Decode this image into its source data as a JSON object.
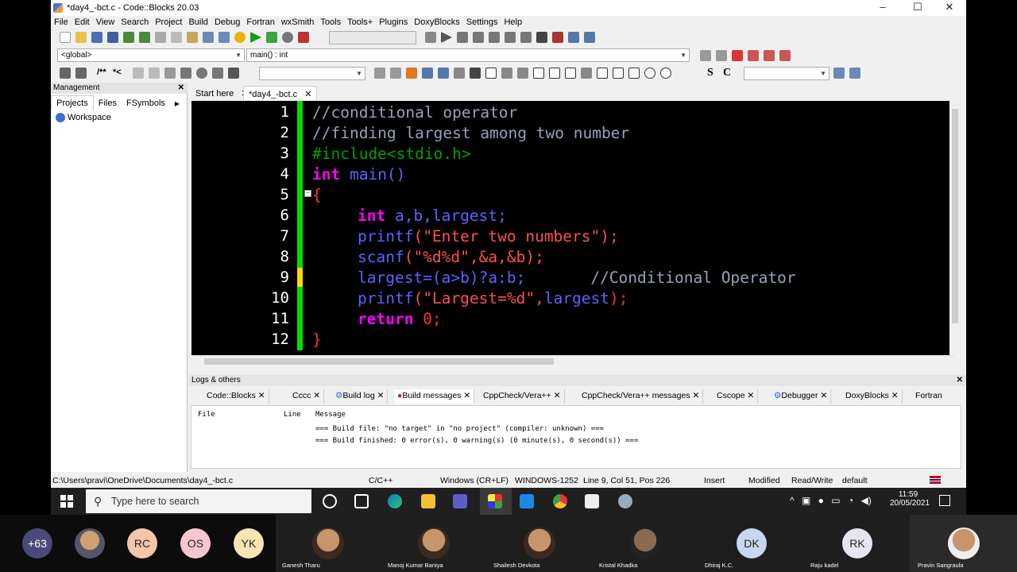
{
  "window": {
    "title": "*day4_-bct.c - Code::Blocks 20.03",
    "controls": [
      "–",
      "☐",
      "✕"
    ]
  },
  "menu": [
    "File",
    "Edit",
    "View",
    "Search",
    "Project",
    "Build",
    "Debug",
    "Fortran",
    "wxSmith",
    "Tools",
    "Tools+",
    "Plugins",
    "DoxyBlocks",
    "Settings",
    "Help"
  ],
  "scope": {
    "global": "<global>",
    "function": "main() : int"
  },
  "toolbar3": {
    "comment_btn": "/**",
    "uncomment_btn": "*<",
    "s_btn": "S",
    "c_btn": "C"
  },
  "management": {
    "header": "Management",
    "tabs": [
      "Projects",
      "Files",
      "FSymbols"
    ],
    "workspace": "Workspace"
  },
  "editor_tabs": [
    "Start here",
    "*day4_-bct.c"
  ],
  "line_numbers": [
    "1",
    "2",
    "3",
    "4",
    "5",
    "6",
    "7",
    "8",
    "9",
    "10",
    "11",
    "12"
  ],
  "code": {
    "l1": "//conditional operator",
    "l2": "//finding largest among two number",
    "l3": "#include<stdio.h>",
    "l4_kw": "int",
    "l4_rest": " main()",
    "l5": "{",
    "l6_kw": "int",
    "l6_rest": " a,b,largest;",
    "l7_fn": "printf",
    "l7_str": "(\"Enter two numbers\");",
    "l8_fn": "scanf",
    "l8_str": "(\"%d%d\",&a,&b);",
    "l9_code": "largest=(a>b)?a:b;",
    "l9_comment": "//Conditional Operator",
    "l10_fn": "printf",
    "l10_str": "(\"Largest=%d\",",
    "l10_var": "largest",
    "l10_end": ");",
    "l11_kw": "return",
    "l11_rest": " 0;",
    "l12": "}"
  },
  "logs": {
    "header": "Logs & others",
    "tabs": [
      "Code::Blocks",
      "Cccc",
      "Build log",
      "Build messages",
      "CppCheck/Vera++",
      "CppCheck/Vera++ messages",
      "Cscope",
      "Debugger",
      "DoxyBlocks",
      "Fortran"
    ],
    "columns": [
      "File",
      "Line",
      "Message"
    ],
    "messages": [
      "=== Build file: \"no target\" in \"no project\" (compiler: unknown) ===",
      "=== Build finished: 0 error(s), 0 warning(s) (0 minute(s), 0 second(s)) ==="
    ]
  },
  "status": {
    "path": "C:\\Users\\pravi\\OneDrive\\Documents\\day4_-bct.c",
    "lang": "C/C++",
    "eol": "Windows (CR+LF)",
    "encoding": "WINDOWS-1252",
    "position": "Line 9, Col 51, Pos 226",
    "mode": "Insert",
    "modified": "Modified",
    "rw": "Read/Write",
    "profile": "default"
  },
  "taskbar": {
    "search_placeholder": "Type here to search",
    "time": "11:59",
    "date": "20/05/2021"
  },
  "meeting": {
    "more_count": "+63",
    "initials": [
      "RC",
      "OS",
      "YK"
    ],
    "participants": [
      "Ganesh Tharu",
      "Manoj Kumar Baniya",
      "Shailesh Devkota",
      "Kristal Khadka",
      "Dhiraj K.C.",
      "Raju kadel",
      "Pravin Sangraula"
    ],
    "tile_initials": [
      "DK",
      "RK"
    ]
  },
  "colors": {
    "editor_bg": "#000000",
    "comment": "#9aa0b8",
    "preprocessor": "#00a000",
    "keyword": "#ff00ff",
    "function": "#6060ff",
    "string": "#ff5050",
    "change_bar": "#00e000"
  }
}
